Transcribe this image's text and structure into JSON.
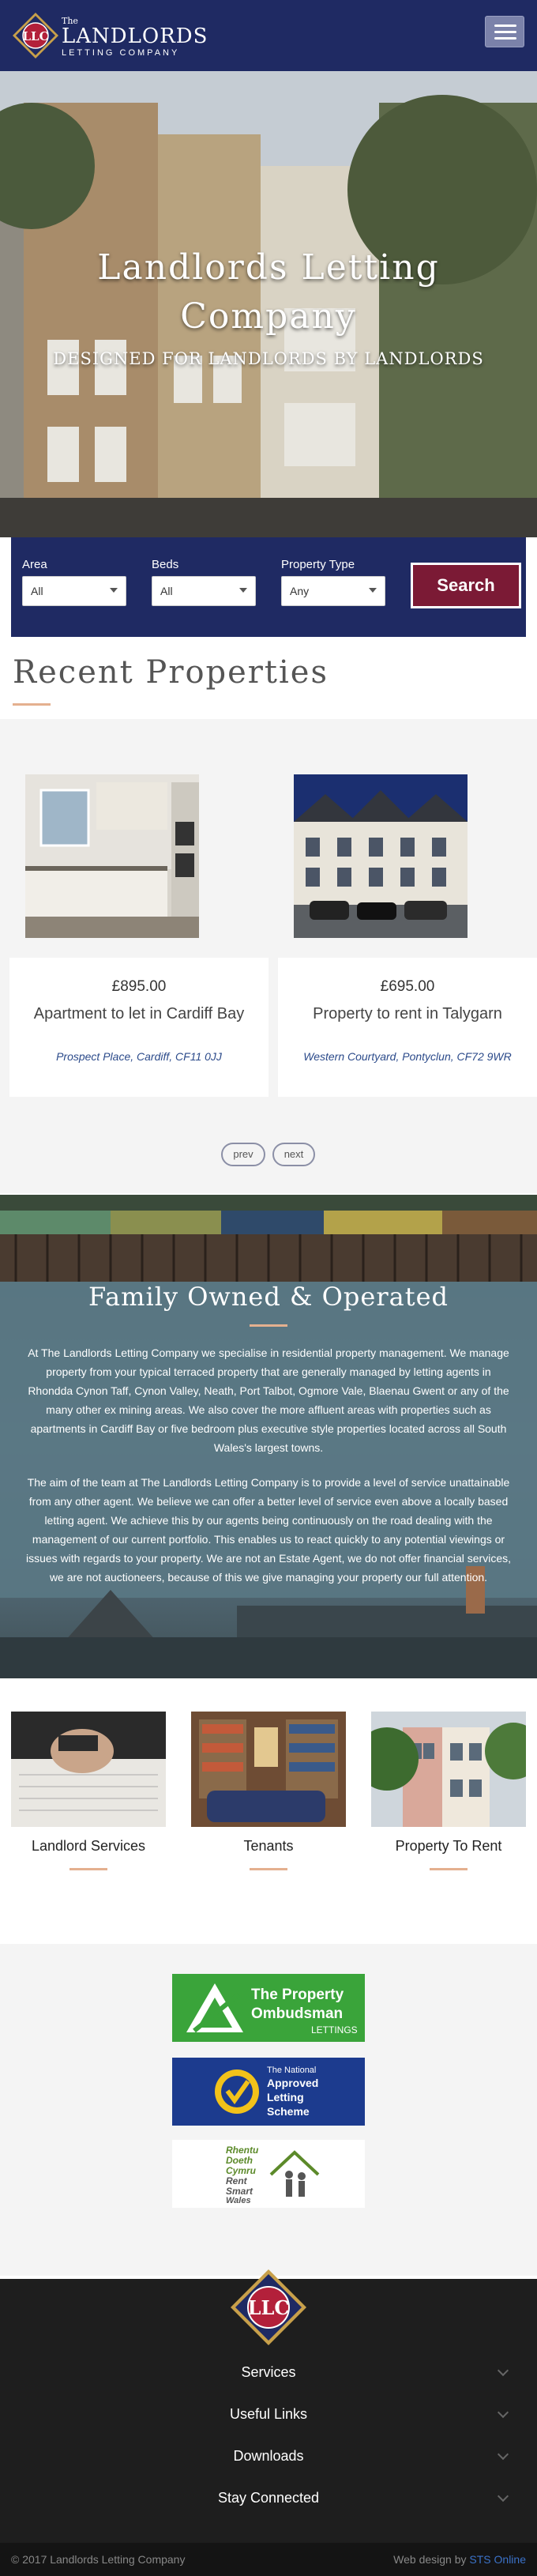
{
  "header": {
    "logo_text": "LLC",
    "brand_the": "The",
    "brand_name": "LANDLORDS",
    "brand_sub": "LETTING COMPANY"
  },
  "hero": {
    "title_line1": "Landlords Letting",
    "title_line2": "Company",
    "subtitle": "DESIGNED FOR LANDLORDS BY LANDLORDS"
  },
  "search": {
    "area_label": "Area",
    "area_value": "All",
    "beds_label": "Beds",
    "beds_value": "All",
    "type_label": "Property Type",
    "type_value": "Any",
    "button_label": "Search"
  },
  "recent": {
    "heading": "Recent Properties",
    "properties": [
      {
        "price": "£895.00",
        "title": "Apartment to let in Cardiff Bay",
        "address": "Prospect Place, Cardiff, CF11 0JJ"
      },
      {
        "price": "£695.00",
        "title": "Property to rent in Talygarn",
        "address": "Western Courtyard, Pontyclun, CF72 9WR"
      }
    ],
    "prev_label": "prev",
    "next_label": "next"
  },
  "family": {
    "heading": "Family Owned & Operated",
    "paragraph1": "At The Landlords Letting Company we specialise in residential property management. We manage property from your typical terraced property that are generally managed by letting agents in Rhondda Cynon Taff, Cynon Valley, Neath, Port Talbot, Ogmore Vale, Blaenau Gwent or any of the many other ex mining areas. We also cover the more affluent areas with properties such as apartments in Cardiff Bay or five bedroom plus executive style properties located across all South Wales's largest towns.",
    "paragraph2": "The aim of the team at The Landlords Letting Company is to provide a level of service unattainable from any other agent. We believe we can offer a better level of service even above a locally based letting agent. We achieve this by our agents being continuously on the road dealing with the management of our current portfolio. This enables us to react quickly to any potential viewings or issues with regards to your property. We are not an Estate Agent, we do not offer financial services, we are not auctioneers, because of this we give managing your property our full attention."
  },
  "services": [
    {
      "label": "Landlord Services"
    },
    {
      "label": "Tenants"
    },
    {
      "label": "Property To Rent"
    }
  ],
  "badges": {
    "ombudsman_line1": "The Property",
    "ombudsman_line2": "Ombudsman",
    "ombudsman_line3": "LETTINGS",
    "letting_line1": "The National",
    "letting_line2": "Approved",
    "letting_line3": "Letting",
    "letting_line4": "Scheme",
    "rsw_line1": "Rhentu",
    "rsw_line2": "Doeth",
    "rsw_line3": "Cymru",
    "rsw_line4": "Rent",
    "rsw_line5": "Smart",
    "rsw_line6": "Wales"
  },
  "footer": {
    "logo_text": "LLC",
    "accordion": [
      "Services",
      "Useful Links",
      "Downloads",
      "Stay Connected"
    ],
    "copyright": "© 2017 Landlords Letting Company",
    "credit_prefix": "Web design by",
    "credit_link": "STS Online"
  },
  "colors": {
    "navy": "#1f2a63",
    "burgundy": "#7b1a35",
    "accent_underline": "#e4b08f",
    "ombudsman_green": "#3aa43a",
    "letting_blue": "#1c3b8e"
  }
}
